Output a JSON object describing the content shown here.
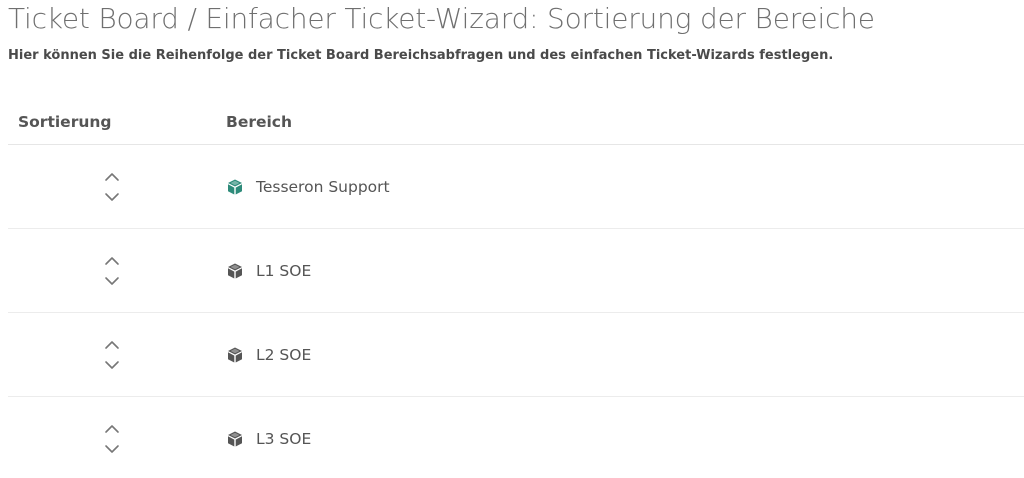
{
  "header": {
    "title": "Ticket Board / Einfacher Ticket-Wizard: Sortierung der Bereiche",
    "subtitle": "Hier können Sie die Reihenfolge der Ticket Board Bereichsabfragen und des einfachen Ticket-Wizards festlegen."
  },
  "table": {
    "columns": {
      "sort": "Sortierung",
      "area": "Bereich"
    },
    "rows": [
      {
        "label": "Tesseron Support",
        "icon": "cube-icon",
        "icon_color": "#2e8b7a"
      },
      {
        "label": "L1 SOE",
        "icon": "cube-icon",
        "icon_color": "#555555"
      },
      {
        "label": "L2 SOE",
        "icon": "cube-icon",
        "icon_color": "#555555"
      },
      {
        "label": "L3 SOE",
        "icon": "cube-icon",
        "icon_color": "#555555"
      }
    ]
  },
  "colors": {
    "accent": "#2e8b7a",
    "text": "#555555",
    "arrow": "#777777"
  }
}
